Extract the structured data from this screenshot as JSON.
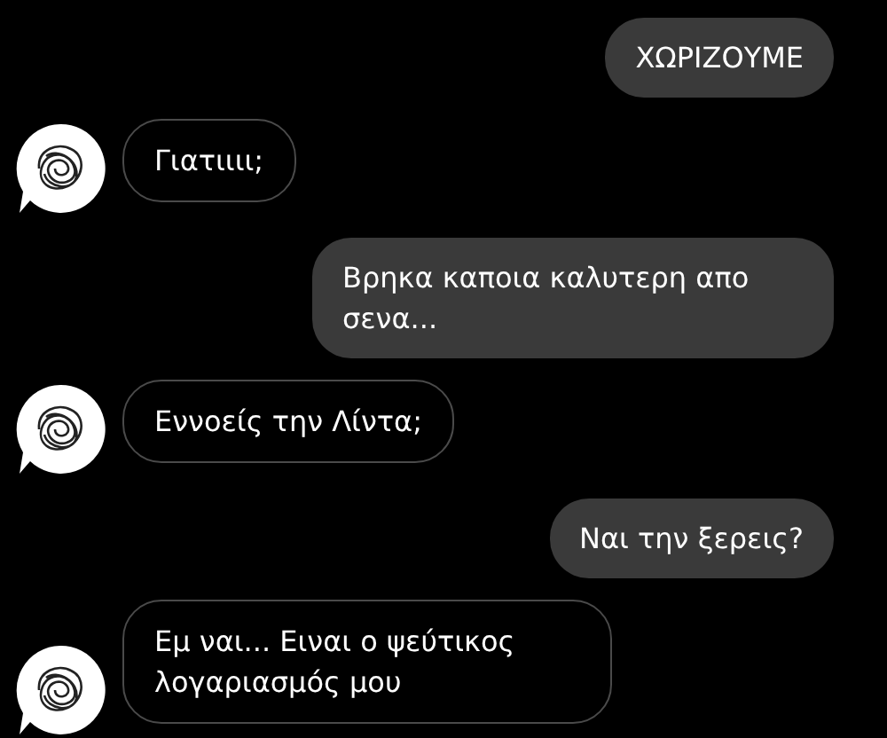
{
  "messages": [
    {
      "kind": "sent",
      "text": "ΧΩΡΙΖΟΥΜΕ"
    },
    {
      "kind": "received",
      "text": "Γιατιιιι;"
    },
    {
      "kind": "sent",
      "text": "Βρηκα καποια καλυτερη απο σενα..."
    },
    {
      "kind": "received",
      "text": "Εννοείς την Λίντα;"
    },
    {
      "kind": "sent",
      "text": "Ναι την ξερεις?"
    },
    {
      "kind": "received",
      "text": "Εμ ναι... Ειναι ο ψεύτικος λογαριασμός μου"
    }
  ]
}
